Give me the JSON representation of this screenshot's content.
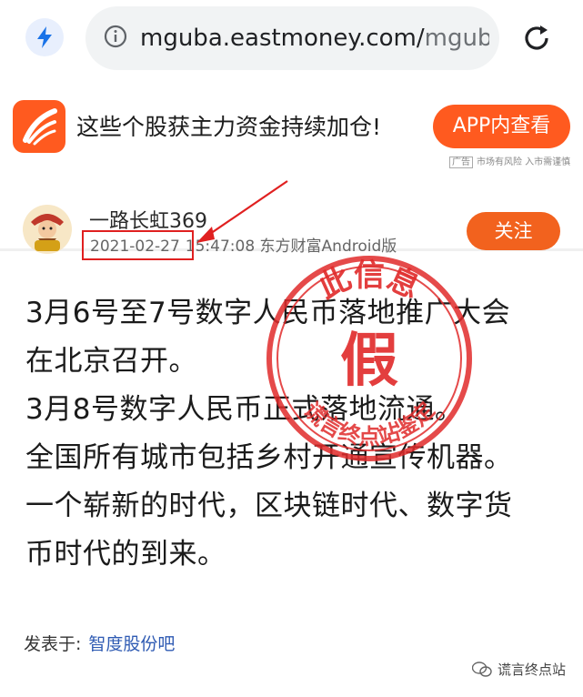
{
  "browser": {
    "url_main": "mguba.eastmoney.com/",
    "url_dim": "mgub",
    "icons": [
      "bolt-icon",
      "info-icon",
      "reload-icon"
    ]
  },
  "ad": {
    "text": "这些个股获主力资金持续加仓!",
    "button": "APP内查看",
    "tag_box": "广告",
    "tag_text": "市场有风险 入市需谨慎",
    "brand_color": "#ff5a1f"
  },
  "post": {
    "username": "一路长虹369",
    "date": "2021-02-27",
    "time_source": "15:47:08 东方财富Android版",
    "follow_label": "关注",
    "lines": [
      "3月6号至7号数字人民币落地推广大会",
      "在北京召开。",
      "3月8号数字人民币正式落地流通。",
      "全国所有城市包括乡村开通宣传机器。",
      "一个崭新的时代，区块链时代、数字货",
      "币时代的到来。"
    ],
    "posted_in_label": "发表于:",
    "posted_in_link": "智度股份吧"
  },
  "stamp": {
    "top_text": "此信息",
    "center_text": "假",
    "bottom_text": "谎言终点站鉴定",
    "color": "#e02a2a"
  },
  "watermark": {
    "text": "谎言终点站"
  }
}
